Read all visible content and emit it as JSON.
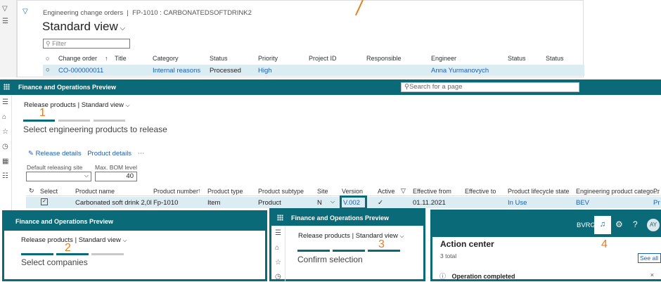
{
  "top": {
    "breadcrumb": "Engineering change orders  |  FP-1010 : CARBONATEDSOFTDRINK2",
    "view_title": "Standard view",
    "filter_placeholder": "Filter",
    "columns": [
      "Change order",
      "Title",
      "Category",
      "Status",
      "Priority",
      "Project ID",
      "Responsible",
      "Engineer",
      "Status",
      "Status"
    ],
    "row": {
      "change_order": "CO-000000011",
      "category": "Internal reasons",
      "status": "Processed",
      "priority": "High",
      "engineer": "Anna Yurmanovych"
    }
  },
  "main": {
    "app_name": "Finance and Operations Preview",
    "search_placeholder": "Search for a page",
    "breadcrumb_page": "Release products",
    "breadcrumb_view": "Standard view",
    "step_number": "1",
    "step_title": "Select engineering products to release",
    "actions": {
      "release_details": "Release details",
      "product_details": "Product details",
      "more": "⋯"
    },
    "fields": {
      "site_label": "Default releasing site",
      "bom_label": "Max. BOM level",
      "bom_value": "40"
    },
    "columns": [
      "Select",
      "Product name",
      "Product number",
      "Product type",
      "Product subtype",
      "Site",
      "Version",
      "Active",
      "Effective from",
      "Effective to",
      "Product lifecycle state",
      "Engineering product catego...",
      "Pr"
    ],
    "row": {
      "product_name": "Carbonated soft drink 2,0l",
      "product_number": "Fp-1010",
      "product_type": "Item",
      "product_subtype": "Product",
      "site": "N",
      "version": "V.002",
      "active": "✓",
      "effective_from": "01.11.2021",
      "lifecycle": "In Use",
      "category": "BEV",
      "pr": "Pr"
    }
  },
  "panel2": {
    "app_name": "Finance and Operations Preview",
    "breadcrumb_page": "Release products",
    "breadcrumb_view": "Standard view",
    "step_number": "2",
    "step_title": "Select companies"
  },
  "panel3": {
    "app_name": "Finance and Operations Preview",
    "breadcrumb_page": "Release products",
    "breadcrumb_view": "Standard view",
    "step_number": "3",
    "step_title": "Confirm selection"
  },
  "panel4": {
    "company": "BVRG",
    "avatar": "AY",
    "step_number": "4",
    "title": "Action center",
    "count": "3 total",
    "see_all": "See all",
    "notification": "Operation completed"
  },
  "colors": {
    "teal": "#0b6a78",
    "row_highlight": "#dcecf3",
    "link": "#1a5fb4",
    "step": "#e67e22"
  }
}
